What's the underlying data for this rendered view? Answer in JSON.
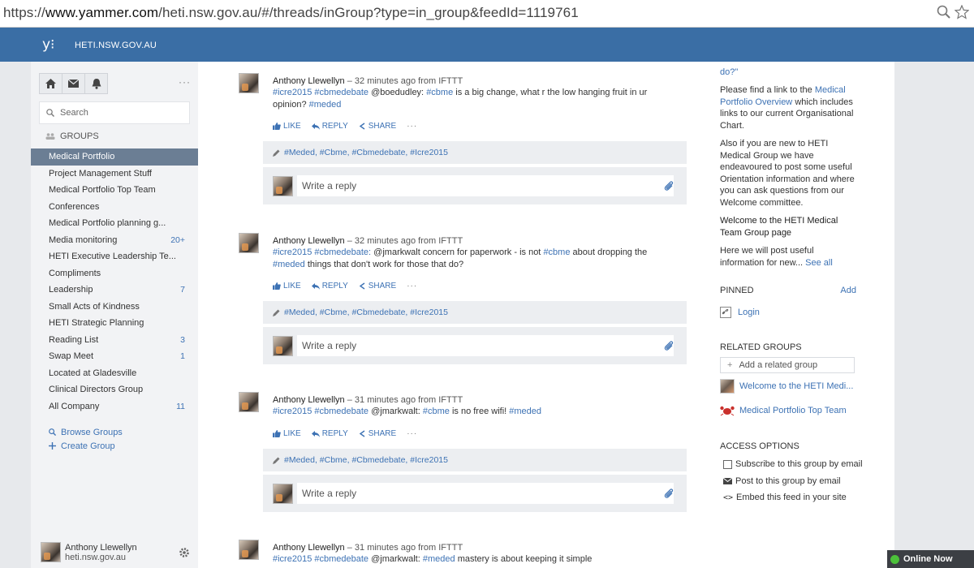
{
  "browser": {
    "url_prefix": "https://",
    "url_domain": "www.yammer.com",
    "url_path": "/heti.nsw.gov.au/#/threads/inGroup?type=in_group&feedId=1119761"
  },
  "topnav": {
    "logo": "y⁝",
    "network": "HETI.NSW.GOV.AU"
  },
  "sidebar": {
    "search_placeholder": "Search",
    "groups_title": "GROUPS",
    "groups": [
      {
        "label": "Medical Portfolio",
        "count": ""
      },
      {
        "label": "Project Management Stuff",
        "count": ""
      },
      {
        "label": "Medical Portfolio Top Team",
        "count": ""
      },
      {
        "label": "Conferences",
        "count": ""
      },
      {
        "label": "Medical Portfolio planning g...",
        "count": ""
      },
      {
        "label": "Media monitoring",
        "count": "20+"
      },
      {
        "label": "HETI Executive Leadership Te...",
        "count": ""
      },
      {
        "label": "Compliments",
        "count": ""
      },
      {
        "label": "Leadership",
        "count": "7"
      },
      {
        "label": "Small Acts of Kindness",
        "count": ""
      },
      {
        "label": "HETI Strategic Planning",
        "count": ""
      },
      {
        "label": "Reading List",
        "count": "3"
      },
      {
        "label": "Swap Meet",
        "count": "1"
      },
      {
        "label": "Located at Gladesville",
        "count": ""
      },
      {
        "label": "Clinical Directors Group",
        "count": ""
      },
      {
        "label": "All Company",
        "count": "11"
      }
    ],
    "browse_groups": "Browse Groups",
    "create_group": "Create Group",
    "user_name": "Anthony Llewellyn",
    "user_domain": "heti.nsw.gov.au"
  },
  "feed": {
    "labels": {
      "like": "LIKE",
      "reply": "REPLY",
      "share": "SHARE",
      "write_reply": "Write a reply"
    },
    "posts": [
      {
        "author": "Anthony Llewellyn",
        "meta": " – 32 minutes ago from IFTTT",
        "tag1": "#icre2015",
        "tag2": "#cbmedebate",
        "mention": "@boedudley:",
        "tag3": "#cbme",
        "text_a": "is a big change, what r the low hanging fruit in ur opinion?",
        "tag4": "#meded",
        "text_b": "",
        "topics": "#Meded, #Cbme, #Cbmedebate, #Icre2015"
      },
      {
        "author": "Anthony Llewellyn",
        "meta": " – 32 minutes ago from IFTTT",
        "tag1": "#icre2015",
        "tag2": "#cbmedebate:",
        "mention": "@jmarkwalt",
        "tag3": "#cbme",
        "text_a": "concern for paperwork - is not",
        "text_mid": "about dropping the",
        "tag4": "#meded",
        "text_b": "things that don't work for those that do?",
        "topics": "#Meded, #Cbme, #Cbmedebate, #Icre2015"
      },
      {
        "author": "Anthony Llewellyn",
        "meta": " – 31 minutes ago from IFTTT",
        "tag1": "#icre2015",
        "tag2": "#cbmedebate",
        "mention": "@jmarkwalt:",
        "tag3": "#cbme",
        "text_a": "is no free wifi!",
        "tag4": "#meded",
        "text_b": "",
        "topics": "#Meded, #Cbme, #Cbmedebate, #Icre2015"
      },
      {
        "author": "Anthony Llewellyn",
        "meta": " – 31 minutes ago from IFTTT",
        "tag1": "#icre2015",
        "tag2": "#cbmedebate",
        "mention": "@jmarkwalt:",
        "tag3": "#meded",
        "text_a": "mastery is about keeping it simple"
      }
    ]
  },
  "rail": {
    "top_fragment": "do?\"",
    "para1_a": "Please find a link to the",
    "para1_link": "Medical Portfolio Overview",
    "para1_b": "which includes links to our current Organisational Chart.",
    "para2": "Also if you are new to HETI Medical Group we have endeavoured to post some useful Orientation information and where you can ask questions from our Welcome committee.",
    "welcome_title": "Welcome to the HETI Medical Team Group page",
    "welcome_text": "Here we will post useful information for new...",
    "see_all": "See all",
    "pinned": "PINNED",
    "add": "Add",
    "login": "Login",
    "related_groups": "RELATED GROUPS",
    "add_related": "Add a related group",
    "related1": "Welcome to the HETI Medi...",
    "related2": "Medical Portfolio Top Team",
    "access_options": "ACCESS OPTIONS",
    "subscribe": "Subscribe to this group by email",
    "post_email": "Post to this group by email",
    "embed": "Embed this feed in your site"
  },
  "chat": {
    "status": "Online Now"
  }
}
